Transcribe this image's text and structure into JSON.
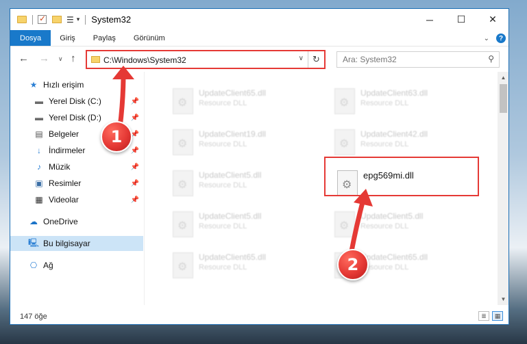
{
  "window": {
    "title": "System32",
    "controls": {
      "minimize": "─",
      "maximize": "☐",
      "close": "✕"
    }
  },
  "ribbon": {
    "tabs": [
      "Dosya",
      "Giriş",
      "Paylaş",
      "Görünüm"
    ]
  },
  "navigation": {
    "address_path": "C:\\Windows\\System32",
    "search_placeholder": "Ara: System32"
  },
  "sidebar": {
    "items": [
      {
        "label": "Hızlı erişim",
        "icon": "star-icon",
        "pinned": false,
        "selected": false
      },
      {
        "label": "Yerel Disk (C:)",
        "icon": "drive-icon",
        "pinned": true,
        "selected": false
      },
      {
        "label": "Yerel Disk (D:)",
        "icon": "drive-icon",
        "pinned": true,
        "selected": false
      },
      {
        "label": "Belgeler",
        "icon": "documents-icon",
        "pinned": true,
        "selected": false
      },
      {
        "label": "İndirmeler",
        "icon": "download-icon",
        "pinned": true,
        "selected": false
      },
      {
        "label": "Müzik",
        "icon": "music-icon",
        "pinned": true,
        "selected": false
      },
      {
        "label": "Resimler",
        "icon": "pictures-icon",
        "pinned": true,
        "selected": false
      },
      {
        "label": "Videolar",
        "icon": "videos-icon",
        "pinned": true,
        "selected": false
      },
      {
        "label": "OneDrive",
        "icon": "cloud-icon",
        "pinned": false,
        "selected": false
      },
      {
        "label": "Bu bilgisayar",
        "icon": "computer-icon",
        "pinned": false,
        "selected": true
      },
      {
        "label": "Ağ",
        "icon": "network-icon",
        "pinned": false,
        "selected": false
      }
    ]
  },
  "files": [
    {
      "name": "UpdateClient65.dll",
      "type": "Resource DLL"
    },
    {
      "name": "UpdateClient63.dll",
      "type": "Resource DLL"
    },
    {
      "name": "UpdateClient19.dll",
      "type": "Resource DLL"
    },
    {
      "name": "UpdateClient42.dll",
      "type": "Resource DLL"
    },
    {
      "name": "UpdateClient5.dll",
      "type": "Resource DLL"
    },
    {
      "name": "epg569mi.dll",
      "type": ""
    },
    {
      "name": "UpdateClient5.dll",
      "type": "Resource DLL"
    },
    {
      "name": "UpdateClient5.dll",
      "type": "Resource DLL"
    },
    {
      "name": "UpdateClient65.dll",
      "type": "Resource DLL"
    },
    {
      "name": "UpdateClient65.dll",
      "type": "Resource DLL"
    }
  ],
  "status": {
    "item_count": "147 öğe"
  },
  "annotations": {
    "step1": "1",
    "step2": "2",
    "color": "#e53935"
  }
}
